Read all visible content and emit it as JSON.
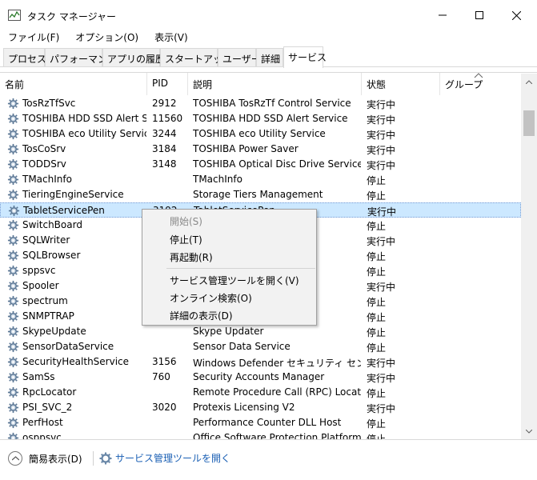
{
  "window": {
    "title": "タスク マネージャー"
  },
  "menu": [
    "ファイル(F)",
    "オプション(O)",
    "表示(V)"
  ],
  "tabs": [
    {
      "label": "プロセス",
      "active": false
    },
    {
      "label": "パフォーマンス",
      "active": false
    },
    {
      "label": "アプリの履歴",
      "active": false
    },
    {
      "label": "スタートアップ",
      "active": false
    },
    {
      "label": "ユーザー",
      "active": false
    },
    {
      "label": "詳細",
      "active": false
    },
    {
      "label": "サービス",
      "active": true
    }
  ],
  "columns": {
    "name": "名前",
    "pid": "PID",
    "desc": "説明",
    "status": "状態",
    "group": "グループ"
  },
  "rows": [
    {
      "name": "TosRzTfSvc",
      "pid": "2912",
      "desc": "TOSHIBA TosRzTf Control Service",
      "status": "実行中"
    },
    {
      "name": "TOSHIBA HDD SSD Alert Se...",
      "pid": "11560",
      "desc": "TOSHIBA HDD SSD Alert Service",
      "status": "実行中"
    },
    {
      "name": "TOSHIBA eco Utility Service",
      "pid": "3244",
      "desc": "TOSHIBA eco Utility Service",
      "status": "実行中"
    },
    {
      "name": "TosCoSrv",
      "pid": "3184",
      "desc": "TOSHIBA Power Saver",
      "status": "実行中"
    },
    {
      "name": "TODDSrv",
      "pid": "3148",
      "desc": "TOSHIBA Optical Disc Drive Service",
      "status": "実行中"
    },
    {
      "name": "TMachInfo",
      "pid": "",
      "desc": "TMachInfo",
      "status": "停止"
    },
    {
      "name": "TieringEngineService",
      "pid": "",
      "desc": "Storage Tiers Management",
      "status": "停止"
    },
    {
      "name": "TabletServicePen",
      "pid": "3192",
      "desc": "TabletServicePen",
      "status": "実行中",
      "selected": true
    },
    {
      "name": "SwitchBoard",
      "pid": "",
      "desc": "",
      "status": "停止"
    },
    {
      "name": "SQLWriter",
      "pid": "",
      "desc": "",
      "status": "実行中"
    },
    {
      "name": "SQLBrowser",
      "pid": "",
      "desc": "",
      "status": "停止"
    },
    {
      "name": "sppsvc",
      "pid": "",
      "desc": "",
      "status": "停止"
    },
    {
      "name": "Spooler",
      "pid": "",
      "desc": "",
      "status": "実行中"
    },
    {
      "name": "spectrum",
      "pid": "",
      "desc": "",
      "status": "停止"
    },
    {
      "name": "SNMPTRAP",
      "pid": "",
      "desc": "",
      "status": "停止"
    },
    {
      "name": "SkypeUpdate",
      "pid": "",
      "desc": "Skype Updater",
      "status": "停止"
    },
    {
      "name": "SensorDataService",
      "pid": "",
      "desc": "Sensor Data Service",
      "status": "停止"
    },
    {
      "name": "SecurityHealthService",
      "pid": "3156",
      "desc": "Windows Defender セキュリティ センター...",
      "status": "実行中"
    },
    {
      "name": "SamSs",
      "pid": "760",
      "desc": "Security Accounts Manager",
      "status": "実行中"
    },
    {
      "name": "RpcLocator",
      "pid": "",
      "desc": "Remote Procedure Call (RPC) Locator",
      "status": "停止"
    },
    {
      "name": "PSI_SVC_2",
      "pid": "3020",
      "desc": "Protexis Licensing V2",
      "status": "実行中"
    },
    {
      "name": "PerfHost",
      "pid": "",
      "desc": "Performance Counter DLL Host",
      "status": "停止"
    },
    {
      "name": "osppsvc",
      "pid": "",
      "desc": "Office Software Protection Platform",
      "status": "停止"
    }
  ],
  "context_menu": [
    {
      "label": "開始(S)",
      "disabled": true
    },
    {
      "label": "停止(T)",
      "disabled": false
    },
    {
      "label": "再起動(R)",
      "disabled": false
    },
    {
      "label": "サービス管理ツールを開く(V)",
      "disabled": false
    },
    {
      "label": "オンライン検索(O)",
      "disabled": false
    },
    {
      "label": "詳細の表示(D)",
      "disabled": false
    }
  ],
  "footer": {
    "toggle_label": "簡易表示(D)",
    "link_label": "サービス管理ツールを開く"
  },
  "colors": {
    "selection": "#cce8ff",
    "link": "#1a5fb4"
  }
}
